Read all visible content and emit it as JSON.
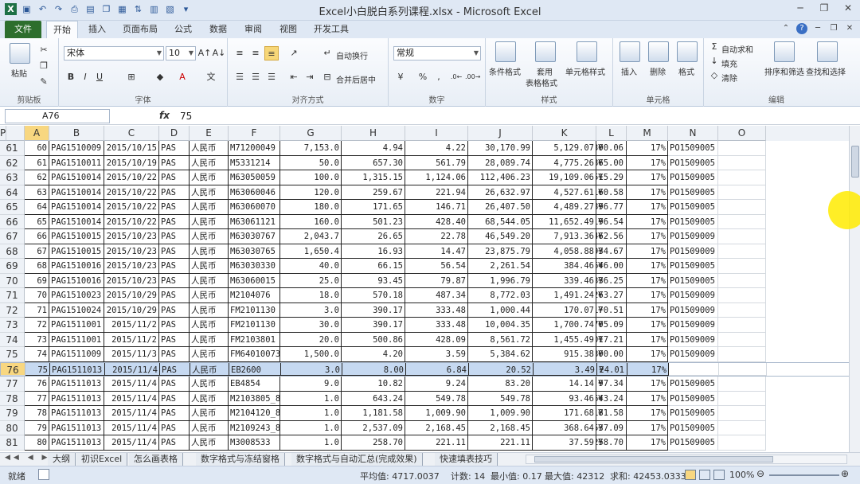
{
  "window": {
    "title": "Excel小白脱白系列课程.xlsx - Microsoft Excel"
  },
  "tabs": [
    "文件",
    "开始",
    "插入",
    "页面布局",
    "公式",
    "数据",
    "审阅",
    "视图",
    "开发工具"
  ],
  "ribbon": {
    "clipboard": {
      "paste": "粘贴",
      "label": "剪贴板"
    },
    "font": {
      "name": "宋体",
      "size": "10",
      "label": "字体"
    },
    "align": {
      "wrap": "自动换行",
      "merge": "合并后居中",
      "label": "对齐方式"
    },
    "number": {
      "format": "常规",
      "label": "数字"
    },
    "styles": {
      "cond": "条件格式",
      "table1": "套用",
      "table2": "表格格式",
      "cell": "单元格样式",
      "label": "样式"
    },
    "cells": {
      "insert": "插入",
      "delete": "删除",
      "format": "格式",
      "label": "单元格"
    },
    "edit": {
      "autosum": "自动求和",
      "fill": "填充",
      "clear": "清除",
      "sort": "排序和筛选",
      "find": "查找和选择",
      "label": "编辑"
    }
  },
  "formula": {
    "namebox": "A76",
    "value": "75"
  },
  "columns": [
    "A",
    "B",
    "C",
    "D",
    "E",
    "F",
    "G",
    "H",
    "I",
    "J",
    "K",
    "L",
    "M",
    "N",
    "O",
    "P"
  ],
  "rows": [
    {
      "n": "61",
      "c": [
        "60",
        "PAG1510009",
        "2015/10/15",
        "PAS",
        "人民币",
        "M71200049",
        "7,153.0",
        "4.94",
        "4.22",
        "30,170.99",
        "5,129.07",
        "¥",
        "35,300.06",
        "17%",
        "PO1509005"
      ]
    },
    {
      "n": "62",
      "c": [
        "61",
        "PAG1510011",
        "2015/10/19",
        "PAS",
        "人民币",
        "M5331214",
        "50.0",
        "657.30",
        "561.79",
        "28,089.74",
        "4,775.26",
        "¥",
        "32,865.00",
        "17%",
        "PO1509005"
      ]
    },
    {
      "n": "63",
      "c": [
        "62",
        "PAG1510014",
        "2015/10/22",
        "PAS",
        "人民币",
        "M63050059",
        "100.0",
        "1,315.15",
        "1,124.06",
        "112,406.23",
        "19,109.06",
        "¥",
        "131,515.29",
        "17%",
        "PO1509005"
      ]
    },
    {
      "n": "64",
      "c": [
        "63",
        "PAG1510014",
        "2015/10/22",
        "PAS",
        "人民币",
        "M63060046",
        "120.0",
        "259.67",
        "221.94",
        "26,632.97",
        "4,527.61",
        "¥",
        "31,160.58",
        "17%",
        "PO1509005"
      ]
    },
    {
      "n": "65",
      "c": [
        "64",
        "PAG1510014",
        "2015/10/22",
        "PAS",
        "人民币",
        "M63060070",
        "180.0",
        "171.65",
        "146.71",
        "26,407.50",
        "4,489.27",
        "¥",
        "30,896.77",
        "17%",
        "PO1509005"
      ]
    },
    {
      "n": "66",
      "c": [
        "65",
        "PAG1510014",
        "2015/10/22",
        "PAS",
        "人民币",
        "M63061121",
        "160.0",
        "501.23",
        "428.40",
        "68,544.05",
        "11,652.49",
        "¥",
        "80,196.54",
        "17%",
        "PO1509005"
      ]
    },
    {
      "n": "67",
      "c": [
        "66",
        "PAG1510015",
        "2015/10/23",
        "PAS",
        "人民币",
        "M63030767",
        "2,043.7",
        "26.65",
        "22.78",
        "46,549.20",
        "7,913.36",
        "¥",
        "54,462.56",
        "17%",
        "PO1509009"
      ]
    },
    {
      "n": "68",
      "c": [
        "67",
        "PAG1510015",
        "2015/10/23",
        "PAS",
        "人民币",
        "M63030765",
        "1,650.4",
        "16.93",
        "14.47",
        "23,875.79",
        "4,058.88",
        "¥",
        "27,934.67",
        "17%",
        "PO1509009"
      ]
    },
    {
      "n": "69",
      "c": [
        "68",
        "PAG1510016",
        "2015/10/23",
        "PAS",
        "人民币",
        "M63030330",
        "40.0",
        "66.15",
        "56.54",
        "2,261.54",
        "384.46",
        "¥",
        "2,646.00",
        "17%",
        "PO1509005"
      ]
    },
    {
      "n": "70",
      "c": [
        "69",
        "PAG1510016",
        "2015/10/23",
        "PAS",
        "人民币",
        "M63060015",
        "25.0",
        "93.45",
        "79.87",
        "1,996.79",
        "339.46",
        "¥",
        "2,336.25",
        "17%",
        "PO1509005"
      ]
    },
    {
      "n": "71",
      "c": [
        "70",
        "PAG1510023",
        "2015/10/29",
        "PAS",
        "人民币",
        "M2104076",
        "18.0",
        "570.18",
        "487.34",
        "8,772.03",
        "1,491.24",
        "¥",
        "10,263.27",
        "17%",
        "PO1509009"
      ]
    },
    {
      "n": "72",
      "c": [
        "71",
        "PAG1510024",
        "2015/10/29",
        "PAS",
        "人民币",
        "FM2101130",
        "3.0",
        "390.17",
        "333.48",
        "1,000.44",
        "170.07",
        "¥",
        "1,170.51",
        "17%",
        "PO1509009"
      ]
    },
    {
      "n": "73",
      "c": [
        "72",
        "PAG1511001",
        "2015/11/2",
        "PAS",
        "人民币",
        "FM2101130",
        "30.0",
        "390.17",
        "333.48",
        "10,004.35",
        "1,700.74",
        "¥",
        "11,705.09",
        "17%",
        "PO1509009"
      ]
    },
    {
      "n": "74",
      "c": [
        "73",
        "PAG1511001",
        "2015/11/2",
        "PAS",
        "人民币",
        "FM2103801",
        "20.0",
        "500.86",
        "428.09",
        "8,561.72",
        "1,455.49",
        "¥",
        "10,017.21",
        "17%",
        "PO1509009"
      ]
    },
    {
      "n": "75",
      "c": [
        "74",
        "PAG1511009",
        "2015/11/3",
        "PAS",
        "人民币",
        "FM64010073",
        "1,500.0",
        "4.20",
        "3.59",
        "5,384.62",
        "915.38",
        "¥",
        "6,300.00",
        "17%",
        "PO1509009"
      ]
    },
    {
      "n": "76",
      "c": [
        "75",
        "PAG1511013",
        "2015/11/4",
        "PAS",
        "人民币",
        "EB2600",
        "3.0",
        "8.00",
        "6.84",
        "20.52",
        "3.49",
        "¥",
        "24.01",
        "17%",
        "PO1509005"
      ]
    },
    {
      "n": "77",
      "c": [
        "76",
        "PAG1511013",
        "2015/11/4",
        "PAS",
        "人民币",
        "EB4854",
        "9.0",
        "10.82",
        "9.24",
        "83.20",
        "14.14",
        "¥",
        "97.34",
        "17%",
        "PO1509005"
      ]
    },
    {
      "n": "78",
      "c": [
        "77",
        "PAG1511013",
        "2015/11/4",
        "PAS",
        "人民币",
        "M2103805_8",
        "1.0",
        "643.24",
        "549.78",
        "549.78",
        "93.46",
        "¥",
        "643.24",
        "17%",
        "PO1509005"
      ]
    },
    {
      "n": "79",
      "c": [
        "78",
        "PAG1511013",
        "2015/11/4",
        "PAS",
        "人民币",
        "M2104120_8",
        "1.0",
        "1,181.58",
        "1,009.90",
        "1,009.90",
        "171.68",
        "¥",
        "1,181.58",
        "17%",
        "PO1509005"
      ]
    },
    {
      "n": "80",
      "c": [
        "79",
        "PAG1511013",
        "2015/11/4",
        "PAS",
        "人民币",
        "M2109243_8",
        "1.0",
        "2,537.09",
        "2,168.45",
        "2,168.45",
        "368.64",
        "¥",
        "2,537.09",
        "17%",
        "PO1509005"
      ]
    },
    {
      "n": "81",
      "c": [
        "80",
        "PAG1511013",
        "2015/11/4",
        "PAS",
        "人民币",
        "M3008533",
        "1.0",
        "258.70",
        "221.11",
        "221.11",
        "37.59",
        "¥",
        "258.70",
        "17%",
        "PO1509005"
      ]
    }
  ],
  "sheets": [
    "大纲",
    "初识Excel",
    "怎么画表格",
    "数字格式与冻结窗格",
    "数字格式与自动汇总(完成效果)",
    "快速填表技巧"
  ],
  "status": {
    "ready": "就绪",
    "avg": "平均值: 4717.0037",
    "count": "计数: 14",
    "min": "最小值: 0.17",
    "max": "最大值: 42312",
    "sum": "求和: 42453.0333",
    "zoom": "100%"
  },
  "colors": {
    "selection": "#c6d9f1",
    "header_highlight": "#f8d780",
    "file_tab": "#2d6e2d"
  }
}
